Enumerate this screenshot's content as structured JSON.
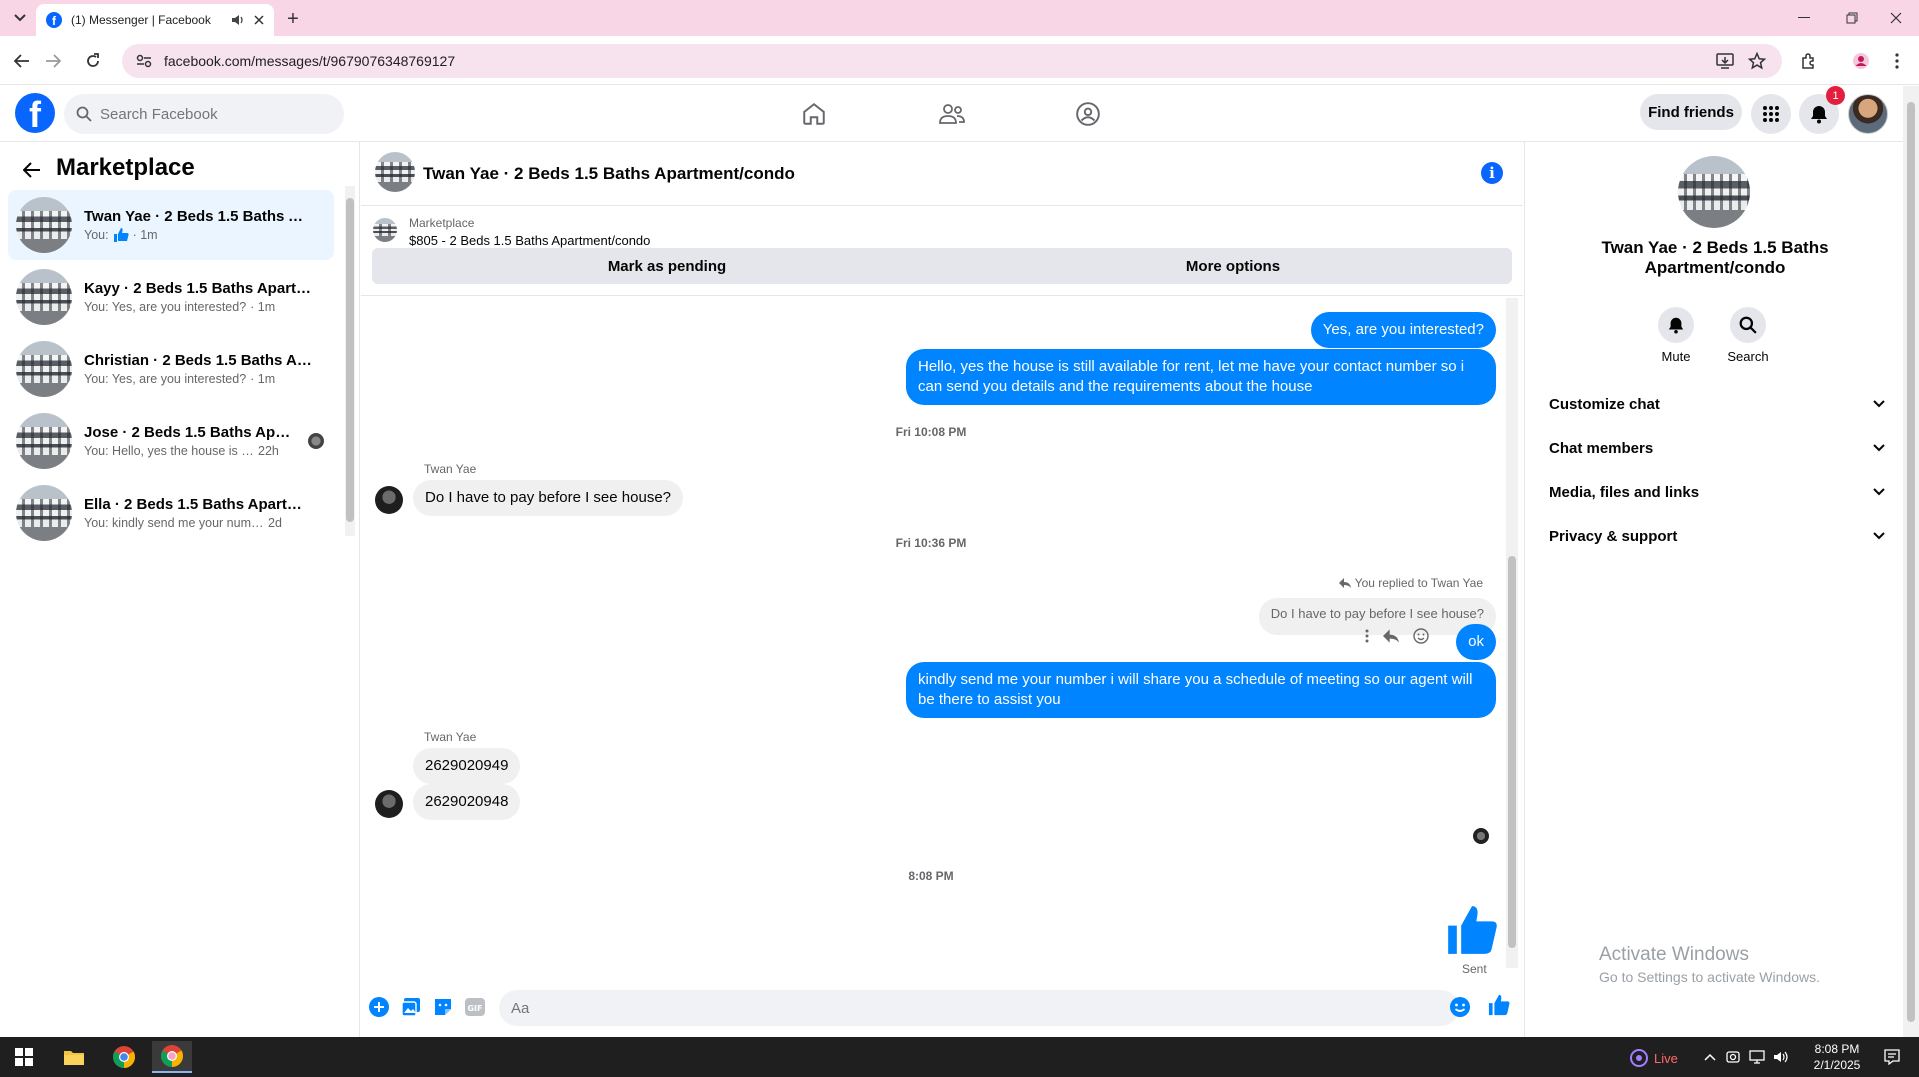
{
  "browser": {
    "tab_title": "(1) Messenger | Facebook",
    "url": "facebook.com/messages/t/9679076348769127"
  },
  "header": {
    "search_placeholder": "Search Facebook",
    "find_friends_label": "Find friends",
    "notification_count": "1",
    "brand_color": "#0866ff"
  },
  "sidebar": {
    "title": "Marketplace",
    "conversations": [
      {
        "name": "Twan Yae · 2 Beds 1.5 Baths Apa...",
        "snippet": "You:",
        "time": "· 1m",
        "active": true
      },
      {
        "name": "Kayy · 2 Beds 1.5 Baths Apartme...",
        "snippet": "You: Yes, are you interested?",
        "time": "· 1m"
      },
      {
        "name": "Christian · 2 Beds 1.5 Baths Apar...",
        "snippet": "You: Yes, are you interested?",
        "time": "· 1m"
      },
      {
        "name": "Jose · 2 Beds 1.5 Baths Apart...",
        "snippet": "You: Hello, yes the house is still...",
        "time": "22h"
      },
      {
        "name": "Ella · 2 Beds 1.5 Baths Apartmen...",
        "snippet": "You: kindly send me your number i...",
        "time": "2d"
      }
    ]
  },
  "chat": {
    "title": "Twan Yae · 2 Beds 1.5 Baths Apartment/condo",
    "marketplace_label": "Marketplace",
    "listing": "$805 - 2 Beds 1.5 Baths Apartment/condo",
    "mark_pending_label": "Mark as pending",
    "more_options_label": "More options",
    "messages": {
      "out1": "Yes, are you interested?",
      "out2": "Hello, yes the house is still available for rent, let me have your contact number so i can send you details and the requirements about the house",
      "stamp1": "Fri 10:08 PM",
      "sender1": "Twan Yae",
      "in1": "Do I have to pay before I see house?",
      "stamp2": "Fri 10:36 PM",
      "replied_label": "You replied to Twan Yae",
      "quoted": "Do I have to pay before I see house?",
      "out3": "ok",
      "out4": "kindly send me your number i will share you a schedule of meeting so our agent will be there to assist you",
      "sender2": "Twan Yae",
      "in2": "2629020949",
      "in3": "2629020948",
      "stamp3": "8:08 PM",
      "sent_label": "Sent"
    },
    "composer_placeholder": "Aa",
    "bubble_color": "#0084ff"
  },
  "details": {
    "title": "Twan Yae · 2 Beds 1.5 Baths Apartment/condo",
    "mute_label": "Mute",
    "search_label": "Search",
    "sections": [
      "Customize chat",
      "Chat members",
      "Media, files and links",
      "Privacy & support"
    ]
  },
  "watermark": {
    "line1": "Activate Windows",
    "line2": "Go to Settings to activate Windows."
  },
  "taskbar": {
    "live_label": "Live",
    "time": "8:08 PM",
    "date": "2/1/2025"
  }
}
